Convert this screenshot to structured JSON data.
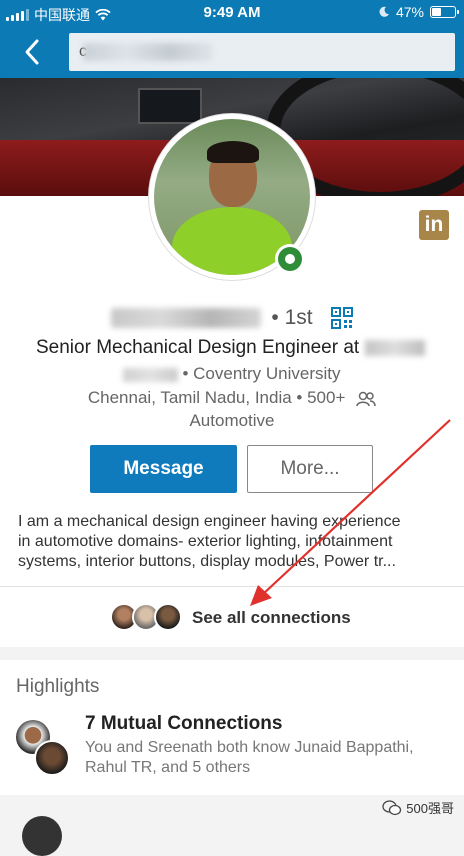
{
  "status_bar": {
    "carrier": "中国联通",
    "time": "9:49 AM",
    "battery_percent": "47%",
    "battery_level": 0.47
  },
  "nav": {
    "back_icon": "chevron-left-icon",
    "search_value": "c"
  },
  "profile": {
    "degree": "• 1st",
    "headline": "Senior Mechanical Design Engineer at",
    "education": "• Coventry University",
    "location": "Chennai, Tamil Nadu, India • 500+",
    "industry": "Automotive",
    "linkedin_badge": "in",
    "online": true
  },
  "actions": {
    "message_label": "Message",
    "more_label": "More..."
  },
  "summary": {
    "lines": [
      "I am a mechanical design engineer having experience",
      "in automotive domains- exterior lighting, infotainment",
      "systems, interior buttons, display modules, Power tr..."
    ]
  },
  "connections": {
    "label": "See all connections"
  },
  "highlights": {
    "title": "Highlights",
    "mutual_title": "7 Mutual Connections",
    "mutual_desc": "You and Sreenath both know Junaid Bappathi, Rahul TR, and 5 others"
  },
  "watermark": {
    "text": "500强哥"
  },
  "colors": {
    "linkedin_blue": "#0c7ab5",
    "button_blue": "#0f7bbd",
    "online_green": "#2f8d3a",
    "badge_gold": "#a8864a",
    "annotation_red": "#e0312c"
  }
}
